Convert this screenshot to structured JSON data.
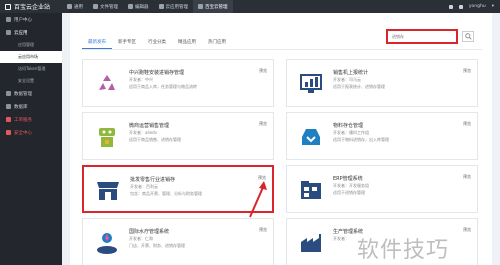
{
  "brand": {
    "name": "百宝云企业站"
  },
  "topnav": {
    "items": [
      {
        "label": "通用"
      },
      {
        "label": "文件管理"
      },
      {
        "label": "编辑器"
      },
      {
        "label": "云应用管理"
      },
      {
        "label": "百宝云管理"
      }
    ],
    "user": "yonghu"
  },
  "sidebar": {
    "groups": [
      {
        "label": "用户中心"
      },
      {
        "label": "云应用"
      },
      {
        "label": "应用管理"
      },
      {
        "label": "云应用市场"
      },
      {
        "label": "访问Token管理"
      },
      {
        "label": "安全设置"
      },
      {
        "label": "数据管理"
      },
      {
        "label": "数据库"
      },
      {
        "label": "工单服务"
      },
      {
        "label": "安全中心"
      }
    ]
  },
  "tabs": [
    {
      "label": "最新发布"
    },
    {
      "label": "新手专区"
    },
    {
      "label": "行业分类"
    },
    {
      "label": "精品应用"
    },
    {
      "label": "热门应用"
    }
  ],
  "search": {
    "placeholder": "进销存"
  },
  "cards": [
    {
      "title": "中兴跑鞋安装进销存管理",
      "dev": "开发者：中兴",
      "desc": "适用于商品入库，任务管理与物品流转",
      "preview": "预览"
    },
    {
      "title": "销售机上报统计",
      "dev": "开发者：司马云",
      "desc": "适用于报表统计、进销存管理",
      "preview": "预览"
    },
    {
      "title": "微商运营销售管理",
      "dev": "开发者：aliedv",
      "desc": "适用于商品销售、进销存管理",
      "preview": "预览"
    },
    {
      "title": "物料存仓管理",
      "dev": "开发者：儒科工作组",
      "desc": "适用于物料进销存，出入库管理",
      "preview": "预览"
    },
    {
      "title": "批发零售行业进销存",
      "dev": "开发者：百利云",
      "desc": "包含：商品开票、管理、分析与财务管理",
      "preview": "预览"
    },
    {
      "title": "ERP管理系统",
      "dev": "开发者：开发服务组",
      "desc": "适用于进销存管理",
      "preview": "预览"
    },
    {
      "title": "国际水疗管理系统",
      "dev": "开发者：仁和",
      "desc": "门店、开票、财务、进销存管理",
      "preview": "预览"
    },
    {
      "title": "生产管理系统",
      "dev": "开发者：",
      "desc": "",
      "preview": "预览"
    }
  ],
  "watermark": "软件技巧",
  "colors": {
    "accent": "#3a7bd5",
    "highlight": "#d9262c",
    "sidebar": "#23262d",
    "topbar": "#2b2f36"
  }
}
